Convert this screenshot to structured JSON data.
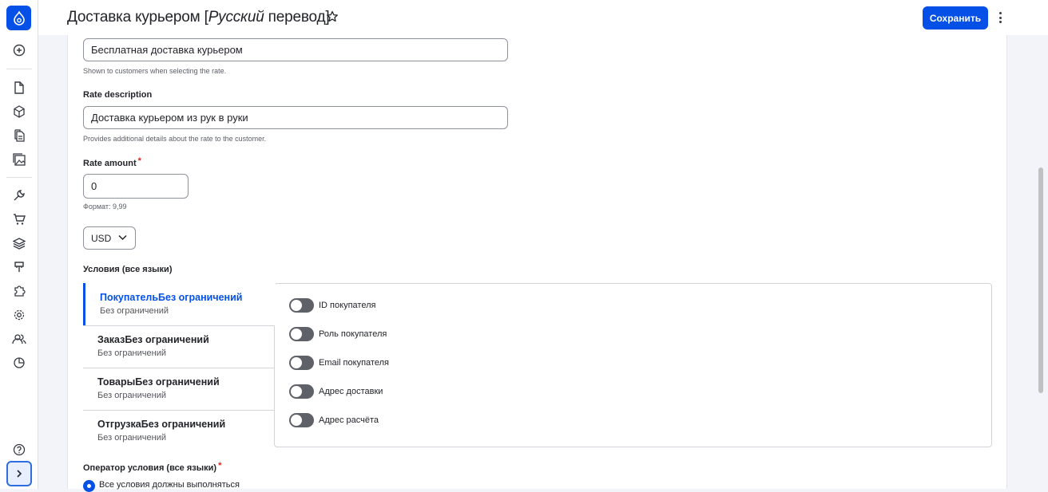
{
  "toolbar": {
    "items": [
      {
        "icon": "plus-circle-icon"
      },
      {
        "icon": "document-icon"
      },
      {
        "icon": "cube-icon"
      },
      {
        "icon": "files-icon"
      },
      {
        "icon": "image-icon"
      },
      {
        "icon": "wrench-icon"
      },
      {
        "icon": "cart-icon"
      },
      {
        "icon": "layers-icon"
      },
      {
        "icon": "brush-icon"
      },
      {
        "icon": "puzzle-icon"
      },
      {
        "icon": "gear-icon"
      },
      {
        "icon": "users-icon"
      },
      {
        "icon": "chart-pie-icon"
      },
      {
        "icon": "help-icon"
      },
      {
        "icon": "chevron-right-icon"
      }
    ]
  },
  "header": {
    "title_prefix": "Доставка курьером [",
    "title_lang": "Русский",
    "title_suffix": " перевод]",
    "save_label": "Сохранить"
  },
  "form": {
    "rate_name_value": "Бесплатная доставка курьером",
    "rate_name_help": "Shown to customers when selecting the rate.",
    "rate_description_label": "Rate description",
    "rate_description_value": "Доставка курьером из рук в руки",
    "rate_description_help": "Provides additional details about the rate to the customer.",
    "rate_amount_label": "Rate amount",
    "required_mark": "*",
    "rate_amount_value": "0",
    "rate_amount_help": "Формат: 9,99",
    "currency_value": "USD",
    "conditions_label": "Условия (все языки)",
    "operator_label": "Оператор условия (все языки)",
    "operator_option": "Все условия должны выполняться"
  },
  "conditions": {
    "tabs": [
      {
        "title": "ПокупательБез ограничений",
        "subtitle": "Без ограничений",
        "active": true
      },
      {
        "title": "ЗаказБез ограничений",
        "subtitle": "Без ограничений",
        "active": false
      },
      {
        "title": "ТоварыБез ограничений",
        "subtitle": "Без ограничений",
        "active": false
      },
      {
        "title": "ОтгрузкаБез ограничений",
        "subtitle": "Без ограничений",
        "active": false
      }
    ],
    "toggles": [
      {
        "label": "ID покупателя",
        "on": false
      },
      {
        "label": "Роль покупателя",
        "on": false
      },
      {
        "label": "Email покупателя",
        "on": false
      },
      {
        "label": "Адрес доставки",
        "on": false
      },
      {
        "label": "Адрес расчёта",
        "on": false
      }
    ]
  },
  "colors": {
    "accent": "#0550e6",
    "toggle_off": "#5f6168",
    "required": "#dc2323"
  }
}
